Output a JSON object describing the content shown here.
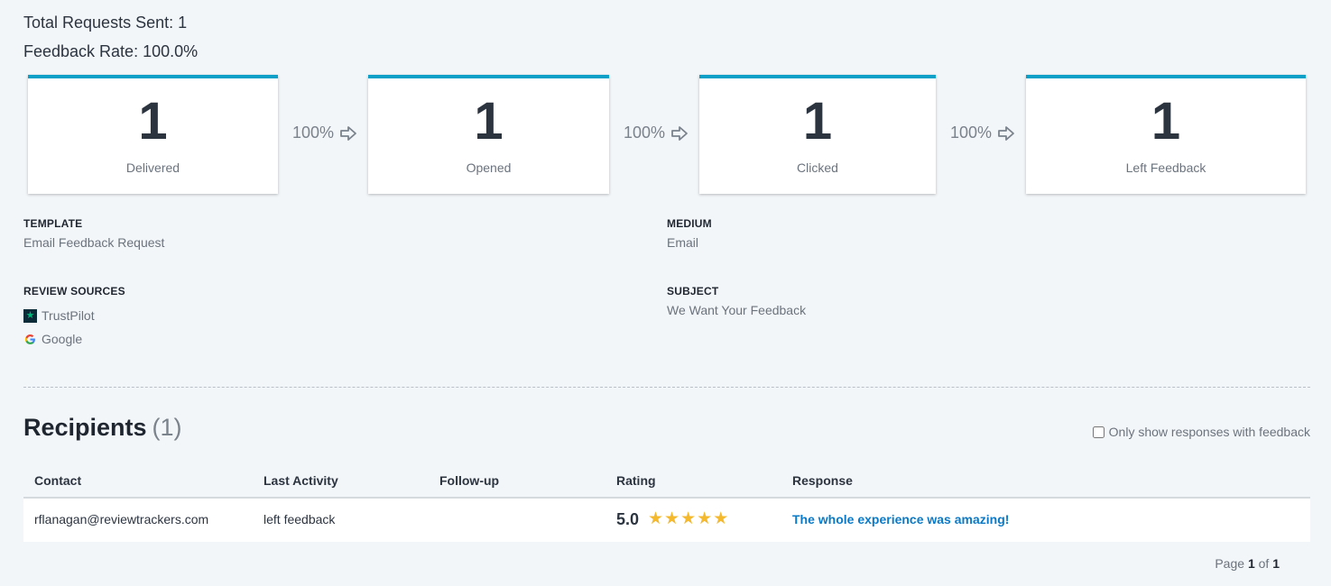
{
  "summary": {
    "total_requests_line": "Total Requests Sent: 1",
    "feedback_rate_line": "Feedback Rate: 100.0%"
  },
  "funnel": {
    "accent_color": "#0aa0c7",
    "cards": [
      {
        "value": "1",
        "label": "Delivered"
      },
      {
        "value": "1",
        "label": "Opened"
      },
      {
        "value": "1",
        "label": "Clicked"
      },
      {
        "value": "1",
        "label": "Left Feedback"
      }
    ],
    "conversions": [
      "100%",
      "100%",
      "100%"
    ]
  },
  "details": {
    "template_label": "TEMPLATE",
    "template_value": "Email Feedback Request",
    "medium_label": "MEDIUM",
    "medium_value": "Email",
    "review_sources_label": "REVIEW SOURCES",
    "review_sources": [
      {
        "name": "TrustPilot",
        "icon": "trustpilot-icon"
      },
      {
        "name": "Google",
        "icon": "google-icon"
      }
    ],
    "subject_label": "SUBJECT",
    "subject_value": "We Want Your Feedback"
  },
  "recipients": {
    "title": "Recipients",
    "count": "(1)",
    "filter_label": "Only show responses with feedback",
    "filter_checked": false,
    "columns": [
      "Contact",
      "Last Activity",
      "Follow-up",
      "Rating",
      "Response"
    ],
    "rows": [
      {
        "contact": "rflanagan@reviewtrackers.com",
        "last_activity": "left feedback",
        "follow_up": "",
        "rating": "5.0",
        "stars": 5,
        "response": "The whole experience was amazing!"
      }
    ],
    "pager": {
      "prefix": "Page",
      "current": "1",
      "of": "of",
      "total": "1"
    }
  },
  "colors": {
    "star": "#f5b92e",
    "link": "#0a7ac8"
  }
}
